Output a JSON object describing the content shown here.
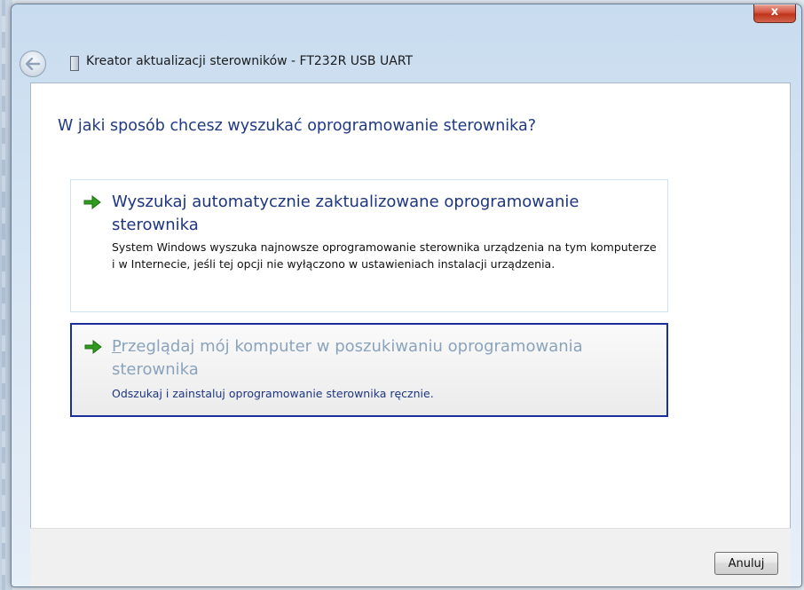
{
  "window": {
    "title": "Kreator aktualizacji sterowników - FT232R USB UART",
    "close_label": "x"
  },
  "main": {
    "question": "W jaki sposób chcesz wyszukać oprogramowanie sterownika?",
    "options": [
      {
        "title": "Wyszukaj automatycznie zaktualizowane oprogramowanie sterownika",
        "description": "System Windows wyszuka najnowsze oprogramowanie sterownika urządzenia na tym komputerze i w Internecie, jeśli tej opcji nie wyłączono w ustawieniach instalacji urządzenia."
      },
      {
        "title_first_letter": "P",
        "title_rest": "rzeglądaj mój komputer w poszukiwaniu oprogramowania sterownika",
        "description": "Odszukaj i zainstaluj oprogramowanie sterownika ręcznie."
      }
    ]
  },
  "footer": {
    "cancel_label": "Anuluj"
  },
  "icons": {
    "back": "back-arrow-icon",
    "wizard": "device-icon",
    "option_arrow": "green-arrow-icon"
  },
  "colors": {
    "heading": "#1f3a83",
    "selected_border": "#1c2e9a",
    "close_button": "#c0321a",
    "arrow_green": "#2f9b1f"
  }
}
